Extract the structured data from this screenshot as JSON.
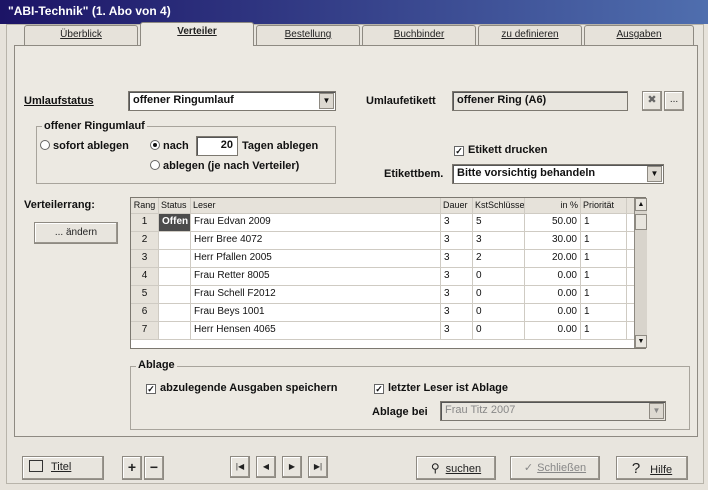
{
  "window": {
    "title": "\"ABI-Technik\" (1. Abo von 4)"
  },
  "tabs": [
    {
      "label": "Überblick"
    },
    {
      "label": "Verteiler"
    },
    {
      "label": "Bestellung"
    },
    {
      "label": "Buchbinder"
    },
    {
      "label": "zu definieren"
    },
    {
      "label": "Ausgaben"
    }
  ],
  "umlauf": {
    "status_label": "Umlaufstatus",
    "status_value": "offener Ringumlauf",
    "etikett_label": "Umlaufetikett",
    "etikett_value": "offener Ring (A6)",
    "etikett_btn_more": "...",
    "etikett_btn_x_icon": "clear-icon"
  },
  "ring": {
    "group_title": "offener Ringumlauf",
    "opt_sofort": "sofort ablegen",
    "opt_nach": "nach",
    "days": "20",
    "days_suffix": "Tagen ablegen",
    "opt_verteiler": "ablegen (je nach Verteiler)"
  },
  "etikett": {
    "drucken_label": "Etikett drucken",
    "drucken_checked": true,
    "bem_label": "Etikettbem.",
    "bem_value": "Bitte vorsichtig behandeln"
  },
  "verteiler": {
    "rang_label": "Verteilerrang:",
    "aendern_button": "... ändern"
  },
  "table": {
    "headers": [
      "Rang",
      "Status",
      "Leser",
      "Dauer",
      "KstSchlüssel",
      "in %",
      "Priorität"
    ],
    "rows": [
      {
        "rang": "1",
        "status": "Offen",
        "leser": "Frau Edvan 2009",
        "dauer": "3",
        "kst": "5",
        "pct": "50.00",
        "prio": "1"
      },
      {
        "rang": "2",
        "status": "",
        "leser": "Herr Bree 4072",
        "dauer": "3",
        "kst": "3",
        "pct": "30.00",
        "prio": "1"
      },
      {
        "rang": "3",
        "status": "",
        "leser": "Herr Pfallen 2005",
        "dauer": "3",
        "kst": "2",
        "pct": "20.00",
        "prio": "1"
      },
      {
        "rang": "4",
        "status": "",
        "leser": "Frau Retter 8005",
        "dauer": "3",
        "kst": "0",
        "pct": "0.00",
        "prio": "1"
      },
      {
        "rang": "5",
        "status": "",
        "leser": "Frau Schell F2012",
        "dauer": "3",
        "kst": "0",
        "pct": "0.00",
        "prio": "1"
      },
      {
        "rang": "6",
        "status": "",
        "leser": "Frau Beys 1001",
        "dauer": "3",
        "kst": "0",
        "pct": "0.00",
        "prio": "1"
      },
      {
        "rang": "7",
        "status": "",
        "leser": "Herr Hensen 4065",
        "dauer": "3",
        "kst": "0",
        "pct": "0.00",
        "prio": "1"
      }
    ]
  },
  "ablage": {
    "group_title": "Ablage",
    "speichern_label": "abzulegende Ausgaben speichern",
    "letzter_label": "letzter Leser ist Ablage",
    "bei_label": "Ablage bei",
    "bei_value": "Frau Titz 2007"
  },
  "footer": {
    "titel": "Titel",
    "plus": "+",
    "minus": "−",
    "nav_first": "|◀",
    "nav_prev": "◀",
    "nav_next": "▶",
    "nav_last": "▶|",
    "suchen": "suchen",
    "schliessen": "Schließen",
    "hilfe": "Hilfe"
  }
}
